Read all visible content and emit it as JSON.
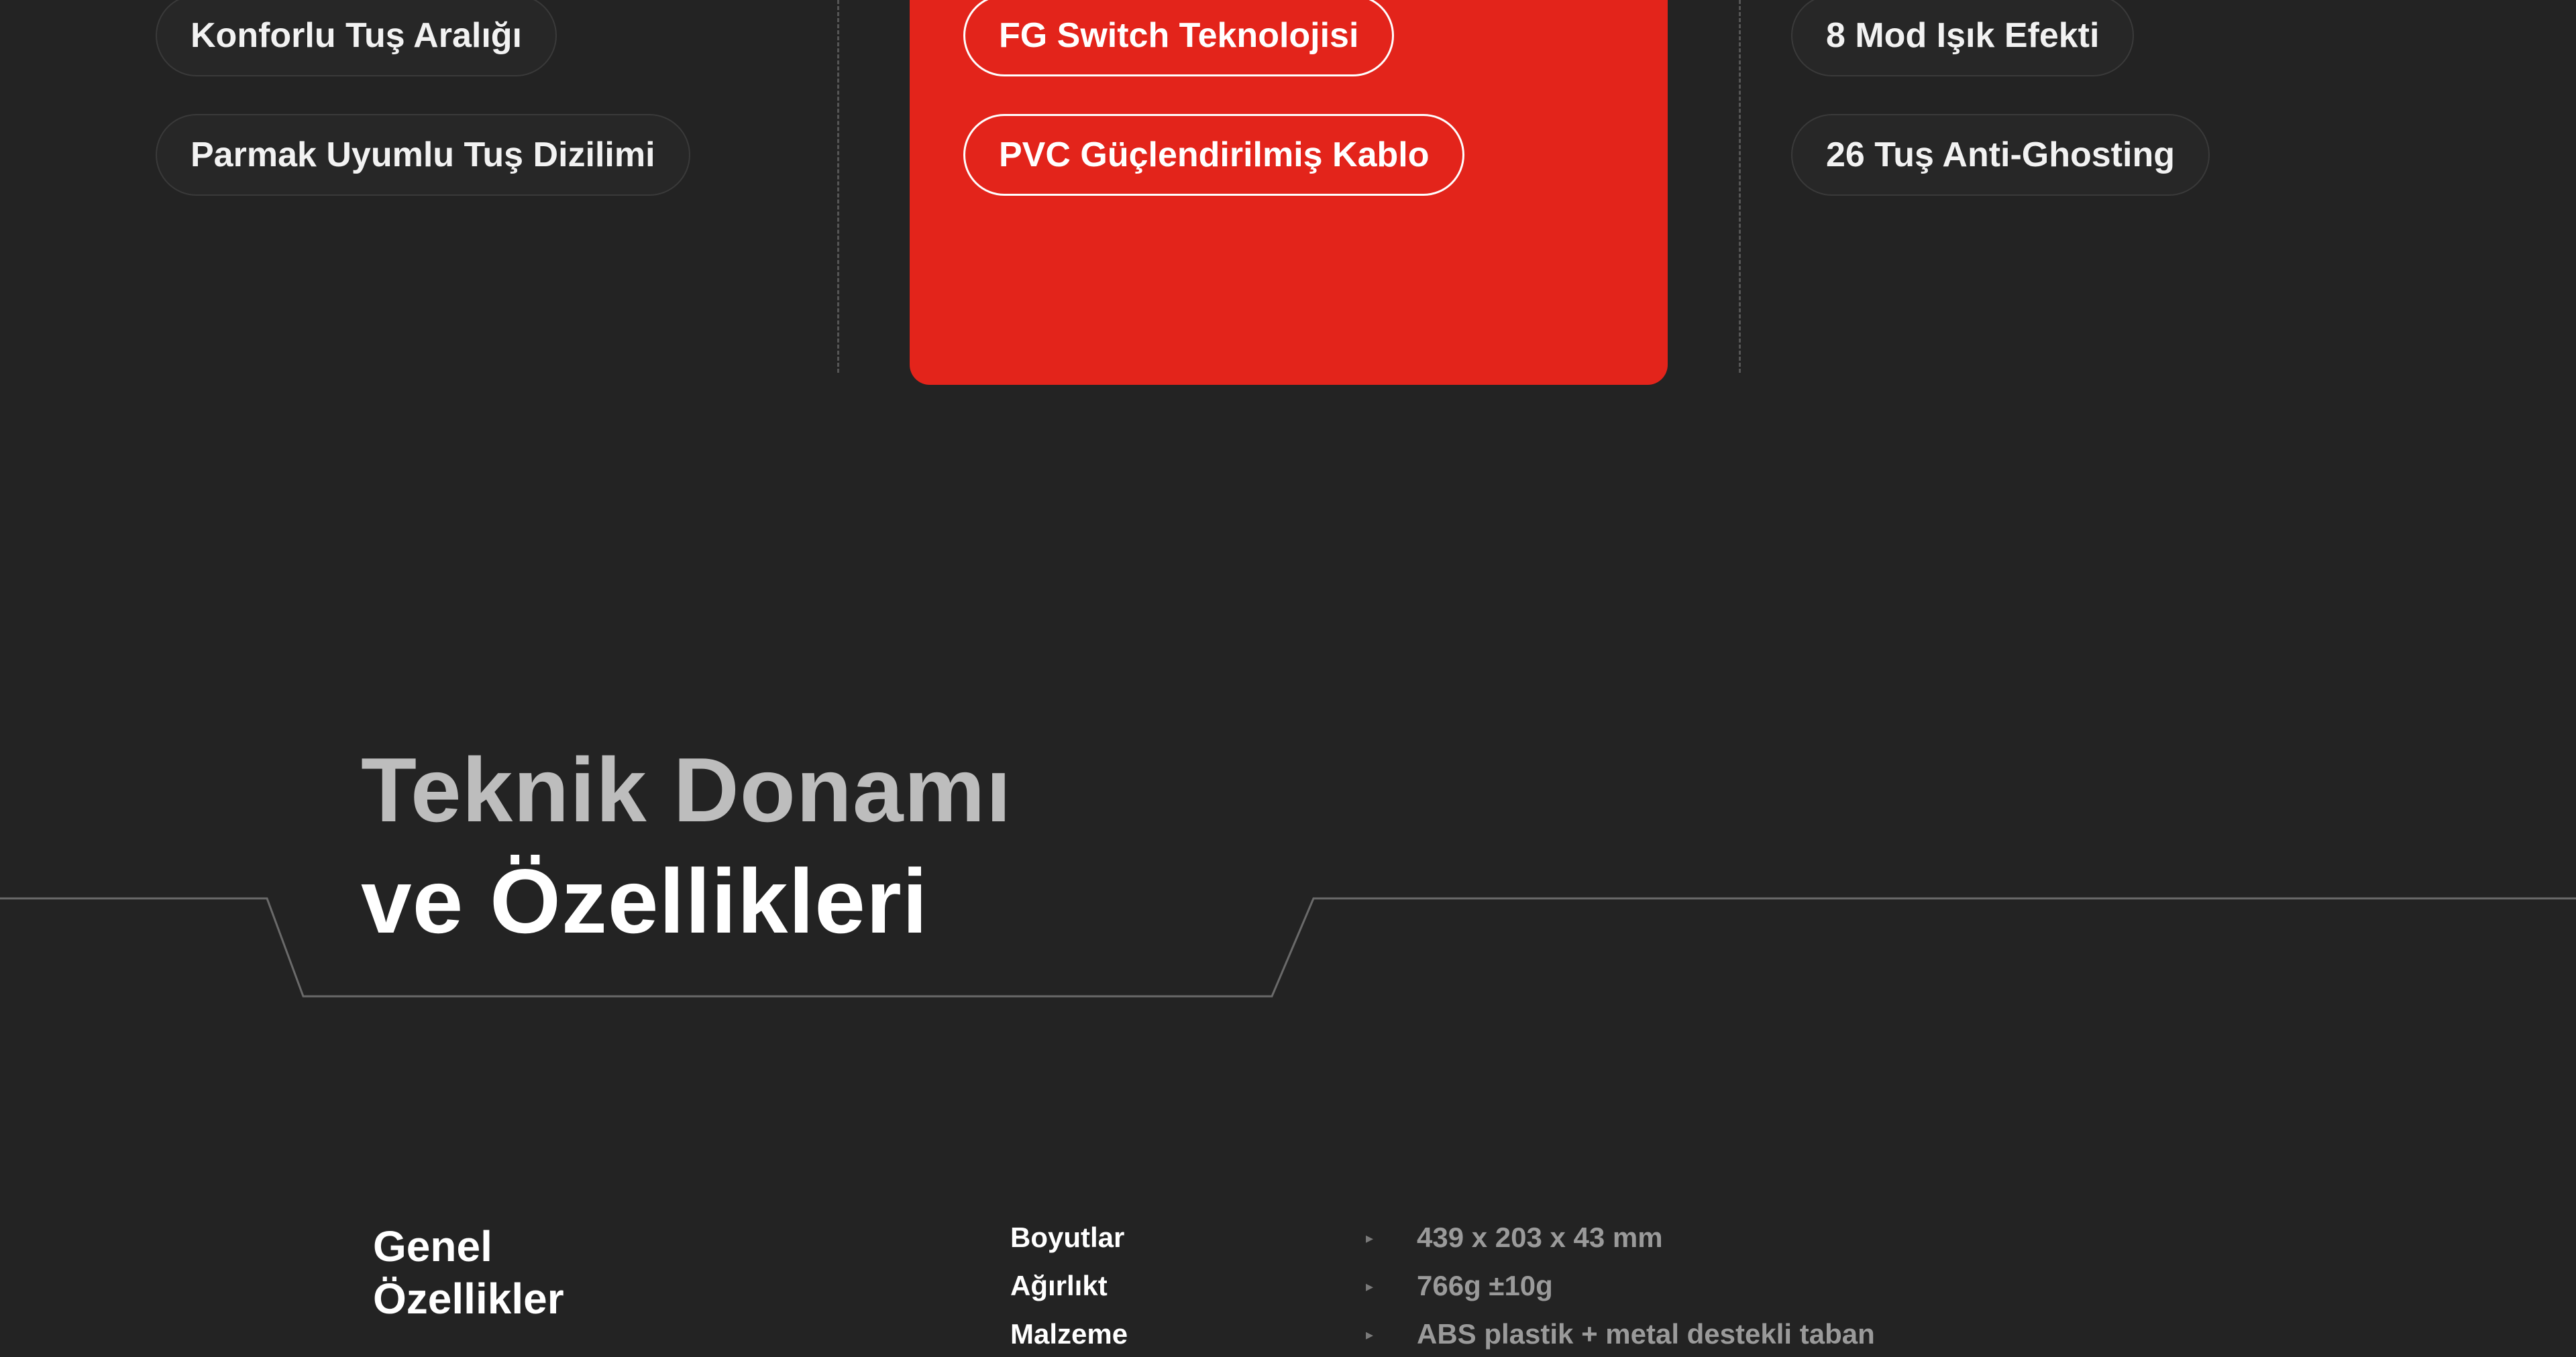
{
  "features": {
    "left": [
      "Konforlu Tuş Aralığı",
      "Parmak Uyumlu Tuş Dizilimi"
    ],
    "center": [
      "FG Switch Teknolojisi",
      "PVC Güçlendirilmiş Kablo"
    ],
    "right": [
      "8 Mod Işık Efekti",
      "26 Tuş Anti-Ghosting"
    ]
  },
  "heading": {
    "line1": "Teknik Donamı",
    "line2": "ve Özellikleri"
  },
  "general": {
    "title_line1": "Genel",
    "title_line2": "Özellikler",
    "bullet_icon": "caret-right-icon",
    "rows": [
      {
        "label": "Boyutlar",
        "value": "439 x 203 x 43 mm"
      },
      {
        "label": "Ağırlıkt",
        "value": "766g ±10g"
      },
      {
        "label": "Malzeme",
        "value": "ABS plastik + metal destekli taban"
      }
    ]
  },
  "colors": {
    "background": "#232323",
    "accent": "#e3241b",
    "pill_border": "#3a3a3a"
  }
}
